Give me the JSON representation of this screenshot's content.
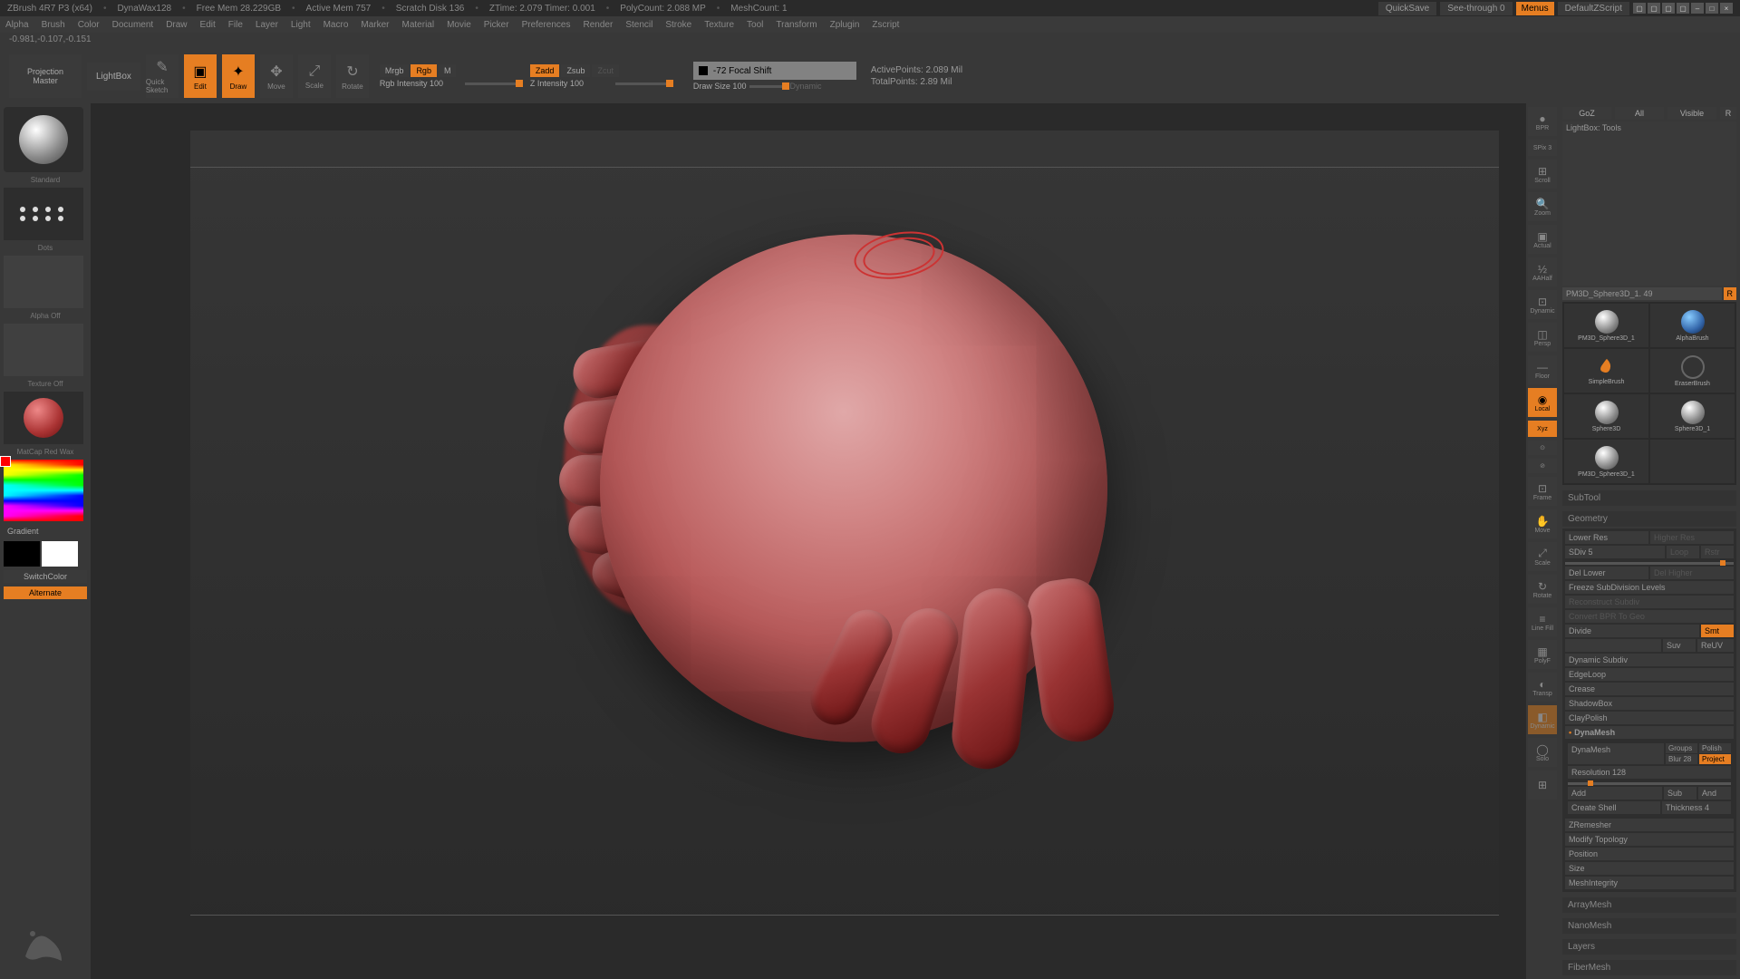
{
  "title_bar": {
    "app": "ZBrush 4R7 P3 (x64)",
    "matcap": "DynaWax128",
    "free_mem": "Free Mem 28.229GB",
    "active_mem": "Active Mem 757",
    "scratch": "Scratch Disk 136",
    "ztime": "ZTime: 2.079 Timer: 0.001",
    "polycount": "PolyCount: 2.088 MP",
    "meshcount": "MeshCount: 1",
    "quicksave": "QuickSave",
    "see_through": "See-through  0",
    "menus": "Menus",
    "default_script": "DefaultZScript"
  },
  "top_menu": [
    "Alpha",
    "Brush",
    "Color",
    "Document",
    "Draw",
    "Edit",
    "File",
    "Layer",
    "Light",
    "Macro",
    "Marker",
    "Material",
    "Movie",
    "Picker",
    "Preferences",
    "Render",
    "Stencil",
    "Stroke",
    "Texture",
    "Tool",
    "Transform",
    "Zplugin",
    "Zscript"
  ],
  "coords": "-0.981,-0.107,-0.151",
  "toolbar": {
    "proj_master": "Projection\nMaster",
    "lightbox": "LightBox",
    "quick_sketch": "Quick Sketch",
    "edit": "Edit",
    "draw": "Draw",
    "move": "Move",
    "scale": "Scale",
    "rotate": "Rotate",
    "mrgb": "Mrgb",
    "rgb": "Rgb",
    "m": "M",
    "rgb_intensity": "Rgb Intensity 100",
    "zadd": "Zadd",
    "zsub": "Zsub",
    "zcut": "Zcut",
    "z_intensity": "Z Intensity 100",
    "focal_shift": "-72 Focal Shift",
    "draw_size": "Draw Size 100",
    "dynamic": "Dynamic",
    "active_points": "ActivePoints: 2.089 Mil",
    "total_points": "TotalPoints: 2.89 Mil"
  },
  "left": {
    "brush": "Standard",
    "stroke": "Dots",
    "alpha": "Alpha Off",
    "texture": "Texture Off",
    "material": "MatCap Red Wax",
    "gradient": "Gradient",
    "switch": "SwitchColor",
    "alternate": "Alternate"
  },
  "right_tools": [
    "BPR",
    "SPix 3",
    "Scroll",
    "Zoom",
    "Actual",
    "AAHalf",
    "Dynamic",
    "Persp",
    "",
    "Floor",
    "Local",
    "Xyz",
    "",
    "",
    "Frame",
    "Move",
    "Scale",
    "Rotate",
    "Line Fill",
    "PolyF",
    "Transp",
    "Dynamic",
    "Solo",
    ""
  ],
  "right_panel": {
    "head": [
      "GoZ",
      "All",
      "Visible",
      "R"
    ],
    "lightbox": "LightBox: Tools",
    "tool_name": "PM3D_Sphere3D_1. 49",
    "tools": [
      "PM3D_Sphere3D_1",
      "AlphaBrush",
      "SimpleBrush",
      "EraserBrush",
      "Sphere3D",
      "Sphere3D_1",
      "PM3D_Sphere3D_1"
    ],
    "subtool": "SubTool",
    "geometry": "Geometry",
    "lower_res": "Lower Res",
    "higher_res": "Higher Res",
    "sdiv": "SDiv 5",
    "loop": "Loop",
    "rstr": "Rstr",
    "del_lower": "Del Lower",
    "del_higher": "Del Higher",
    "freeze": "Freeze SubDivision Levels",
    "reconstruct": "Reconstruct Subdiv",
    "convert": "Convert BPR To Geo",
    "divide": "Divide",
    "smt": "Smt",
    "suv": "Suv",
    "reuv": "ReUV",
    "dyn_subdiv": "Dynamic Subdiv",
    "edgeloop": "EdgeLoop",
    "crease": "Crease",
    "shadowbox": "ShadowBox",
    "claypolish": "ClayPolish",
    "dynamesh_h": "DynaMesh",
    "dynamesh": "DynaMesh",
    "groups": "Groups",
    "polish": "Polish",
    "blur": "Blur 28",
    "project": "Project",
    "resolution": "Resolution 128",
    "add": "Add",
    "sub": "Sub",
    "and": "And",
    "create_shell": "Create Shell",
    "thickness": "Thickness 4",
    "zremesher": "ZRemesher",
    "modify_topo": "Modify Topology",
    "position": "Position",
    "size": "Size",
    "meshintegrity": "MeshIntegrity",
    "arraymesh": "ArrayMesh",
    "nanomesh": "NanoMesh",
    "layers": "Layers",
    "fibermesh": "FiberMesh"
  }
}
